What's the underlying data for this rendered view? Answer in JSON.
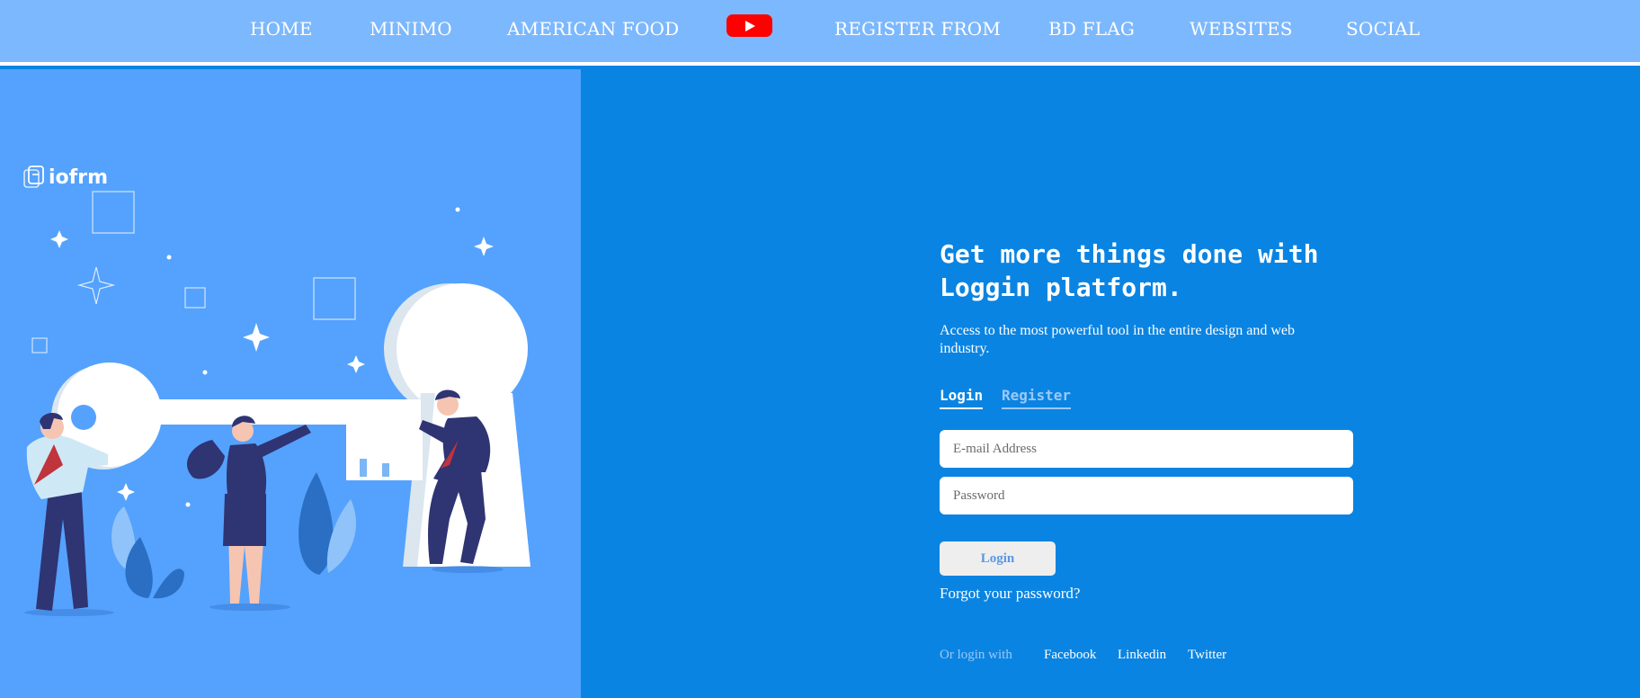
{
  "nav": {
    "items": [
      {
        "label": "HOME"
      },
      {
        "label": "MINIMO"
      },
      {
        "label": "AMERICAN FOOD"
      },
      {
        "label": "REGISTER FROM"
      },
      {
        "label": "BD FLAG"
      },
      {
        "label": "WEBSITES"
      },
      {
        "label": "SOCIAL"
      }
    ],
    "youtube_icon": "youtube-play-icon"
  },
  "brand": {
    "name": "iofrm",
    "icon": "document-logo-icon"
  },
  "hero": {
    "headline": "Get more things done with Loggin platform.",
    "subtitle": "Access to the most powerful tool in the entire design and web industry."
  },
  "tabs": {
    "login": "Login",
    "register": "Register",
    "active": "Login"
  },
  "form": {
    "email_placeholder": "E-mail Address",
    "password_placeholder": "Password",
    "email_value": "",
    "password_value": "",
    "submit_label": "Login",
    "forgot_label": "Forgot your password?"
  },
  "social": {
    "prefix": "Or login with",
    "facebook": "Facebook",
    "linkedin": "Linkedin",
    "twitter": "Twitter"
  },
  "colors": {
    "nav_bg": "#7cb8fd",
    "left_panel": "#54a2fd",
    "right_panel": "#0a84e2",
    "youtube_red": "#ff0000",
    "figure_navy": "#2f3473",
    "tie_red": "#c0343b"
  }
}
